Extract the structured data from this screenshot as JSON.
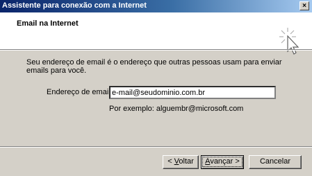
{
  "window": {
    "title": "Assistente para conexão com a Internet",
    "close_glyph": "×"
  },
  "header": {
    "title": "Email na Internet",
    "icon": "wizard-sparkle-icon"
  },
  "body": {
    "description": "Seu endereço de email é o endereço que outras pessoas usam para enviar emails para você.",
    "email_label": "Endereço de email:",
    "email_value": "e-mail@seudominio.com.br",
    "example": "Por exemplo: alguembr@microsoft.com"
  },
  "buttons": {
    "back": {
      "prefix": "< ",
      "accel": "V",
      "rest": "oltar"
    },
    "next": {
      "accel": "A",
      "rest": "vançar >"
    },
    "cancel": "Cancelar"
  }
}
